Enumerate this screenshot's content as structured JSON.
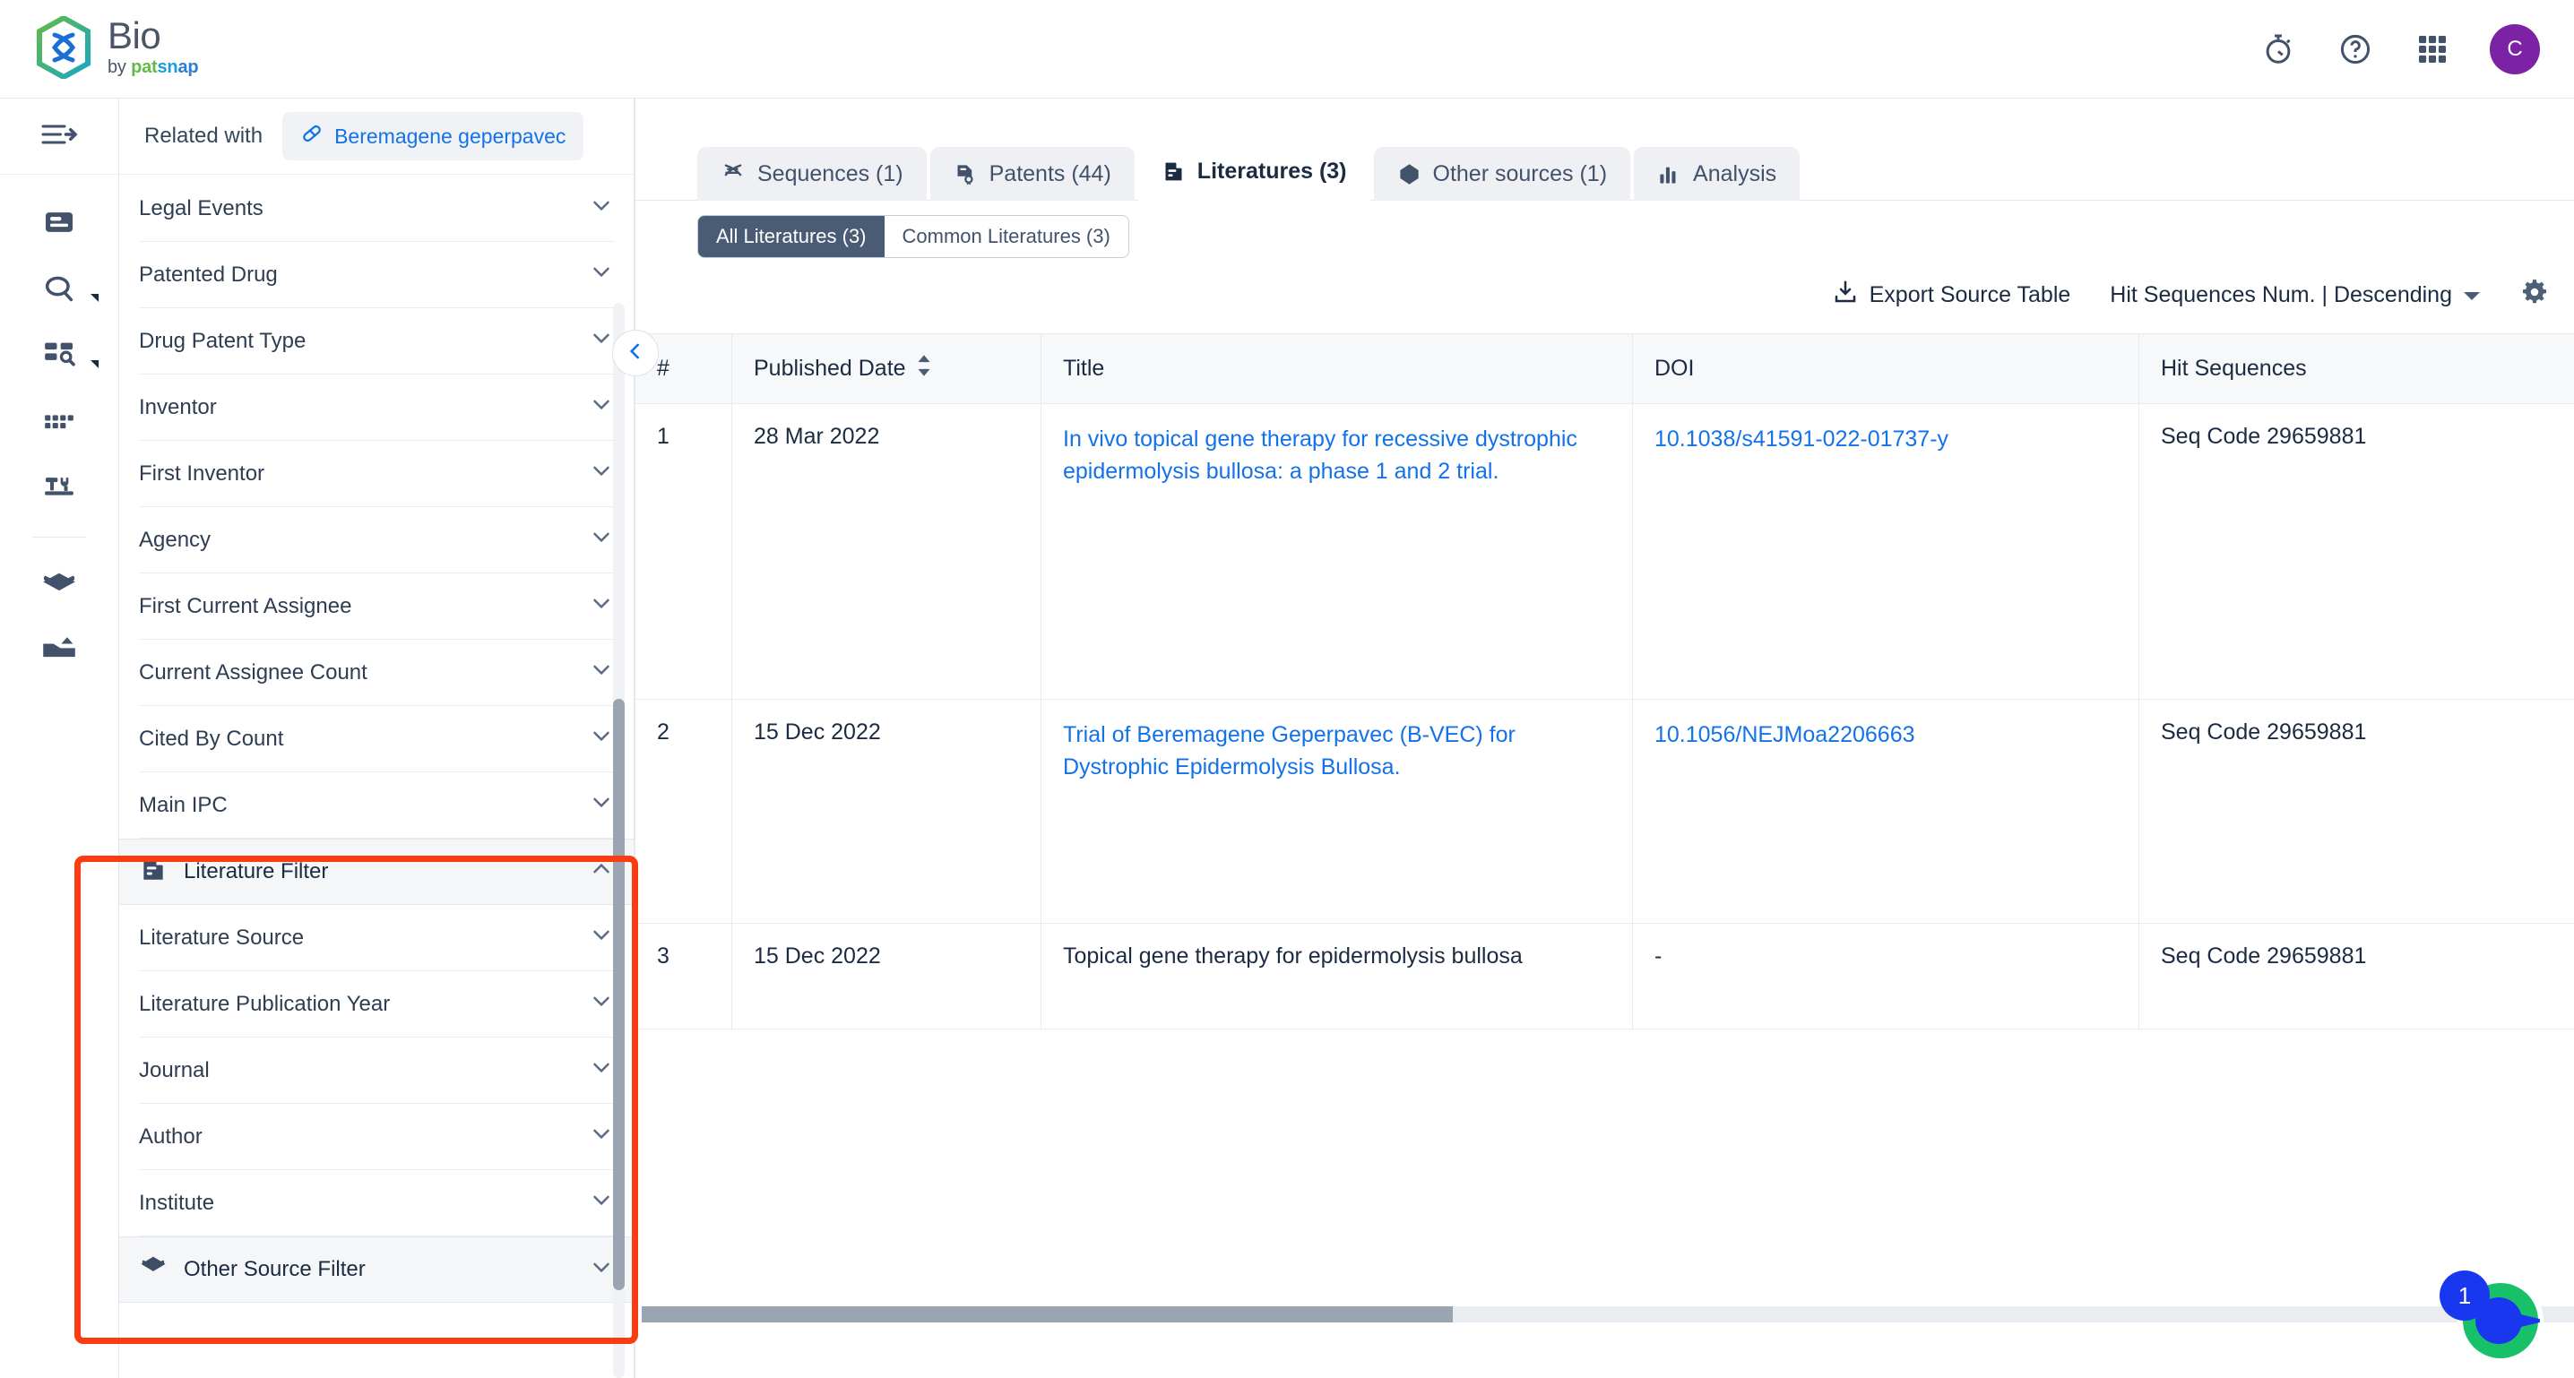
{
  "brand": {
    "title": "Bio",
    "by": "by ",
    "pat": "pat",
    "sn": "sn",
    "ap": "ap"
  },
  "topbar": {
    "icons": [
      {
        "name": "stopwatch-icon"
      },
      {
        "name": "help-circle-icon"
      },
      {
        "name": "apps-grid-icon"
      }
    ],
    "avatar_initial": "C"
  },
  "rail": {
    "items": [
      {
        "name": "collapse-menu-icon"
      },
      {
        "name": "document-icon"
      },
      {
        "name": "search-icon"
      },
      {
        "name": "grid-search-icon"
      },
      {
        "name": "table-columns-icon"
      },
      {
        "name": "workbench-icon"
      },
      {
        "name": "layers-icon"
      },
      {
        "name": "export-tray-icon"
      }
    ]
  },
  "related": {
    "label": "Related with",
    "chip": "Beremagene geperpavec"
  },
  "filters": {
    "rows_top": [
      "Legal Events",
      "Patented Drug",
      "Drug Patent Type",
      "Inventor",
      "First Inventor",
      "Agency",
      "First Current Assignee",
      "Current Assignee Count",
      "Cited By Count",
      "Main IPC"
    ],
    "literature_group": "Literature Filter",
    "literature_rows": [
      "Literature Source",
      "Literature Publication Year",
      "Journal",
      "Author",
      "Institute"
    ],
    "other_group": "Other Source Filter"
  },
  "tabs": [
    {
      "label": "Sequences (1)",
      "icon": "dna-icon",
      "active": false
    },
    {
      "label": "Patents (44)",
      "icon": "patent-doc-icon",
      "active": false
    },
    {
      "label": "Literatures (3)",
      "icon": "literature-icon",
      "active": true
    },
    {
      "label": "Other sources (1)",
      "icon": "hexagon-icon",
      "active": false
    },
    {
      "label": "Analysis",
      "icon": "bar-chart-icon",
      "active": false
    }
  ],
  "subtabs": [
    {
      "label": "All Literatures (3)",
      "active": true
    },
    {
      "label": "Common Literatures (3)",
      "active": false
    }
  ],
  "toolbar": {
    "export_label": "Export Source Table",
    "sort_label": "Hit Sequences Num. | Descending",
    "settings_icon": "gear-icon"
  },
  "table": {
    "columns": [
      "#",
      "Published Date",
      "Title",
      "DOI",
      "Hit Sequences"
    ],
    "rows": [
      {
        "num": "1",
        "date": "28 Mar 2022",
        "title": "In vivo topical gene therapy for recessive dystrophic epidermolysis bullosa: a phase 1 and 2 trial.",
        "title_is_link": true,
        "doi": "10.1038/s41591-022-01737-y",
        "doi_is_link": true,
        "hit": "Seq Code 29659881"
      },
      {
        "num": "2",
        "date": "15 Dec 2022",
        "title": "Trial of Beremagene Geperpavec (B-VEC) for Dystrophic Epidermolysis Bullosa.",
        "title_is_link": true,
        "doi": "10.1056/NEJMoa2206663",
        "doi_is_link": true,
        "hit": "Seq Code 29659881"
      },
      {
        "num": "3",
        "date": "15 Dec 2022",
        "title": "Topical gene therapy for epidermolysis bullosa",
        "title_is_link": false,
        "doi": "-",
        "doi_is_link": false,
        "hit": "Seq Code 29659881"
      }
    ]
  },
  "fab": {
    "badge": "1",
    "name": "chat-widget"
  },
  "colors": {
    "accent_blue": "#1372e8",
    "highlight_red": "#fb3b12",
    "avatar_purple": "#7c22a5",
    "active_tab_dark": "#4a5c75",
    "fab_green": "#18c06a"
  }
}
